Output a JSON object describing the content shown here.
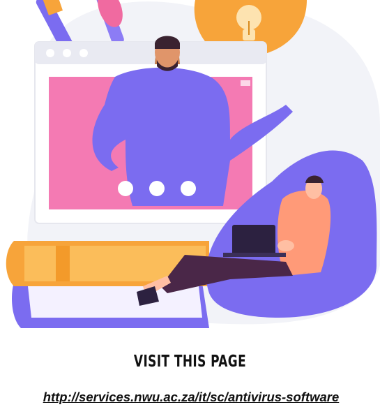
{
  "heading": "VISIT THIS PAGE",
  "link": "http://services.nwu.ac.za/it/sc/antivirus-software",
  "illustration_description": "Online learning illustration: teacher presenting from a browser window, student on a bean bag with a laptop, stack of books, paint brushes and idea lightbulb speech bubble",
  "colors": {
    "purple": "#7b6cf0",
    "pink": "#f06aa0",
    "orange": "#f7a43a",
    "peach": "#ff9a78",
    "dark": "#2c2140"
  }
}
